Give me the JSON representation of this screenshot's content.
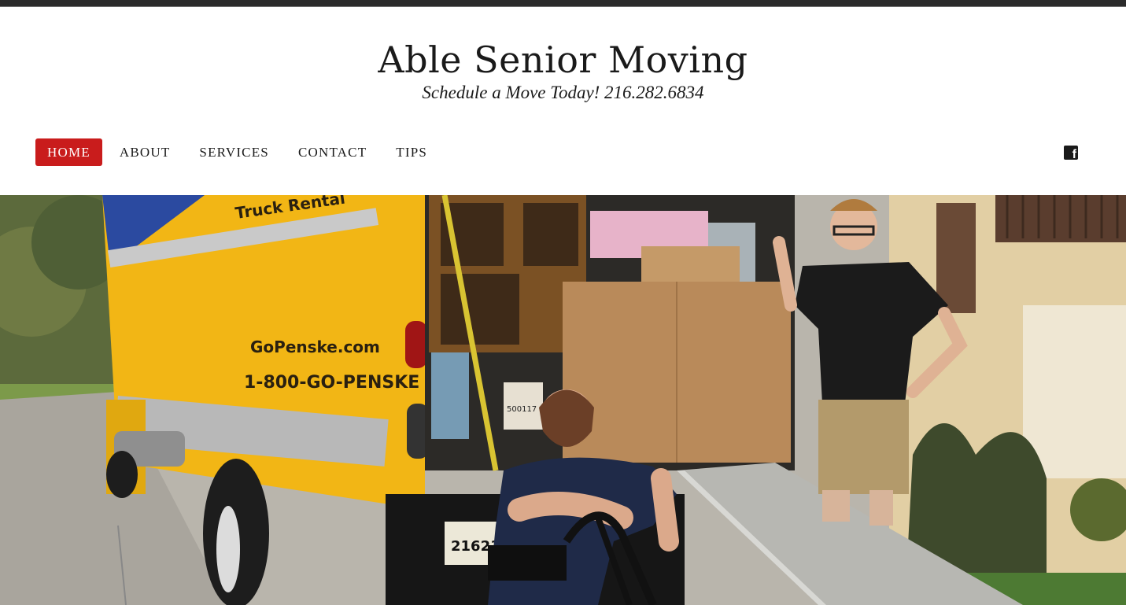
{
  "site": {
    "title": "Able Senior Moving",
    "tagline": "Schedule a Move Today! 216.282.6834"
  },
  "nav": {
    "items": [
      {
        "label": "HOME",
        "active": true
      },
      {
        "label": "ABOUT",
        "active": false
      },
      {
        "label": "SERVICES",
        "active": false
      },
      {
        "label": "CONTACT",
        "active": false
      },
      {
        "label": "TIPS",
        "active": false
      }
    ],
    "active_color": "#c91c1c"
  },
  "social": {
    "icon": "facebook-icon"
  },
  "hero": {
    "truck_text": {
      "brand": "Truck Rental",
      "website": "GoPenske.com",
      "phone": "1-800-GO-PENSKE",
      "plate": "216214",
      "box_label": "500117"
    },
    "colors": {
      "truck": "#f2b615",
      "stripe": "#2b4aa0",
      "box": "#b98a5a",
      "shirt": "#1b1b1b"
    }
  }
}
